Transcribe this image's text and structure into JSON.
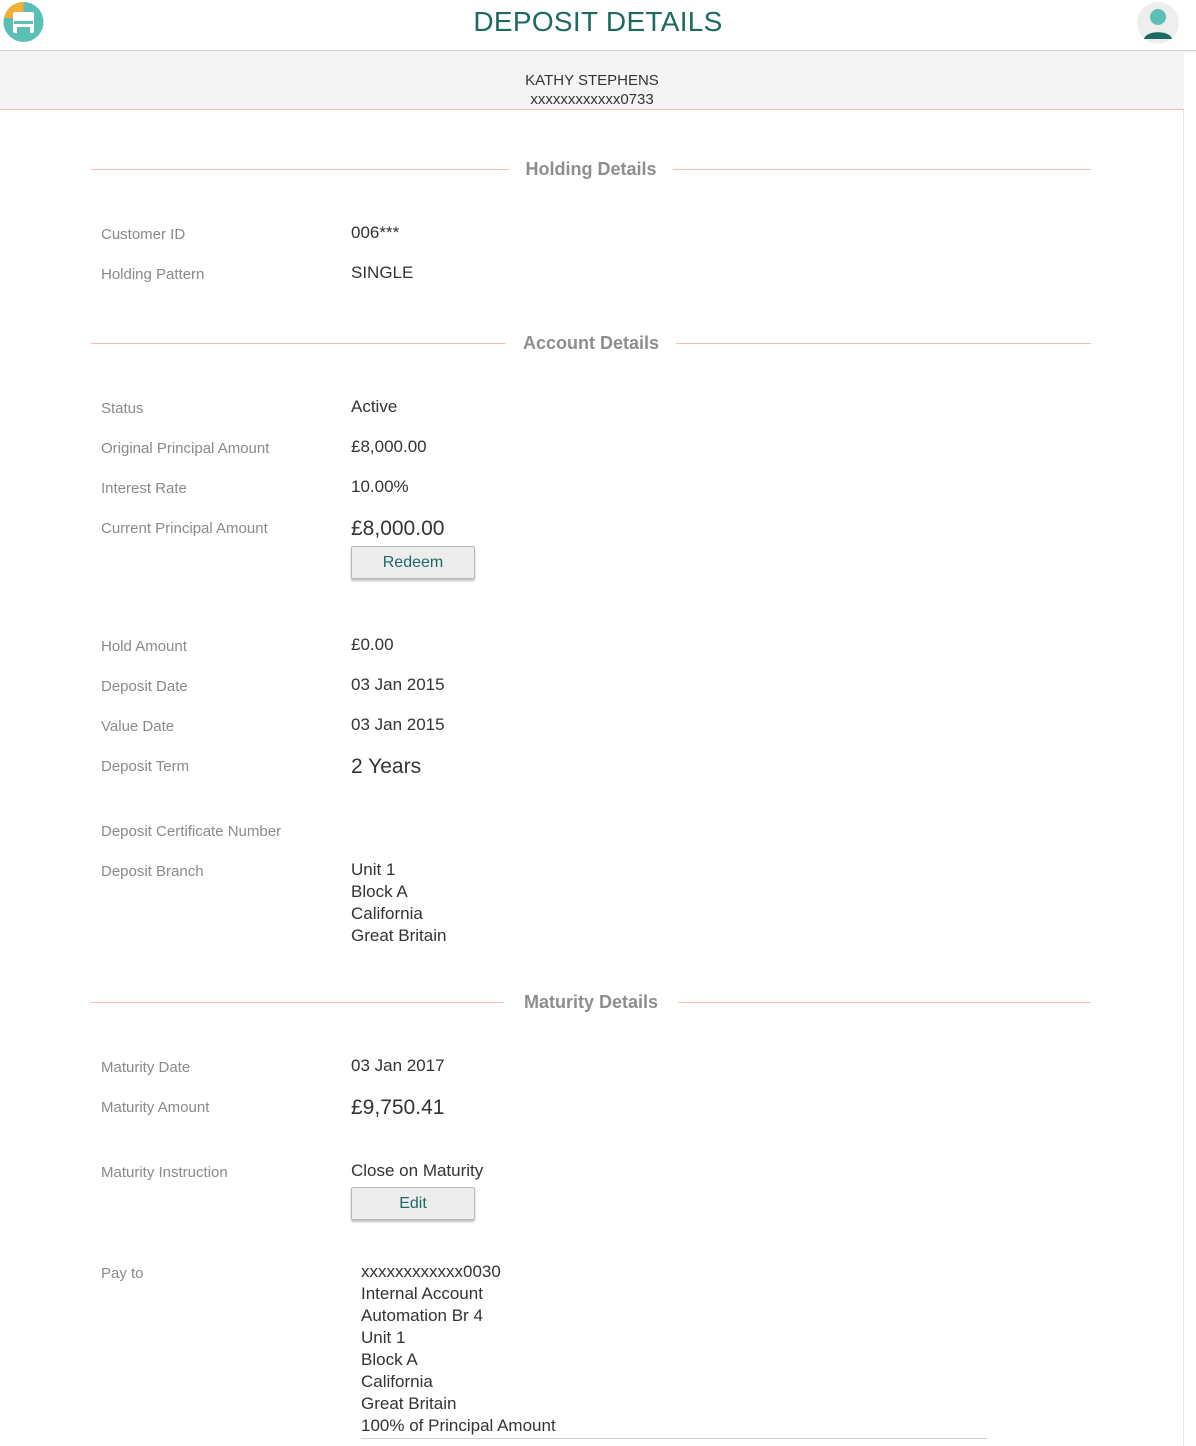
{
  "header": {
    "title": "DEPOSIT DETAILS",
    "customer_name": "KATHY STEPHENS",
    "account_number": "xxxxxxxxxxxx0733"
  },
  "colors": {
    "accent": "#1d6a63",
    "divider": "#efc0b5",
    "label": "#8a8a8a"
  },
  "icons": {
    "logo": "app-logo-icon",
    "user": "user-avatar-icon"
  },
  "holding_details": {
    "title": "Holding Details",
    "customer_id_label": "Customer ID",
    "customer_id": "006***",
    "holding_pattern_label": "Holding Pattern",
    "holding_pattern": "SINGLE"
  },
  "account_details": {
    "title": "Account Details",
    "status_label": "Status",
    "status": "Active",
    "original_principal_label": "Original Principal Amount",
    "original_principal": "£8,000.00",
    "interest_rate_label": "Interest Rate",
    "interest_rate": "10.00%",
    "current_principal_label": "Current Principal Amount",
    "current_principal": "£8,000.00",
    "redeem_label": "Redeem",
    "hold_amount_label": "Hold Amount",
    "hold_amount": "£0.00",
    "deposit_date_label": "Deposit Date",
    "deposit_date": "03 Jan 2015",
    "value_date_label": "Value Date",
    "value_date": "03 Jan 2015",
    "deposit_term_label": "Deposit Term",
    "deposit_term": "2 Years",
    "certificate_number_label": "Deposit Certificate Number",
    "deposit_branch_label": "Deposit Branch",
    "deposit_branch": [
      "Unit 1",
      "Block A",
      "California",
      "Great Britain"
    ]
  },
  "maturity_details": {
    "title": "Maturity Details",
    "maturity_date_label": "Maturity Date",
    "maturity_date": "03 Jan 2017",
    "maturity_amount_label": "Maturity Amount",
    "maturity_amount": "£9,750.41",
    "maturity_instruction_label": "Maturity Instruction",
    "maturity_instruction": "Close on Maturity",
    "edit_label": "Edit",
    "pay_to_label": "Pay to",
    "pay_to": [
      "xxxxxxxxxxxx0030",
      "Internal Account",
      "Automation Br 4",
      "Unit 1",
      "Block A",
      "California",
      "Great Britain",
      "100% of Principal Amount"
    ]
  }
}
